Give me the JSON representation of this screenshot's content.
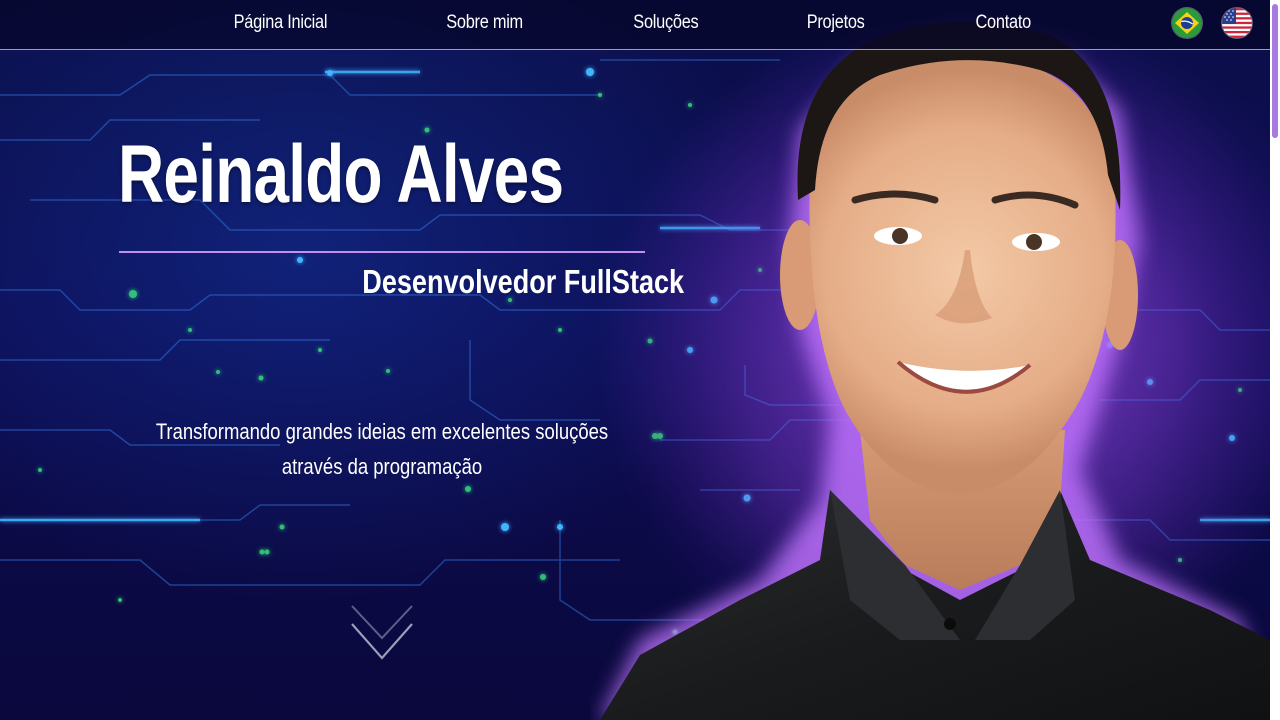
{
  "nav": {
    "items": [
      {
        "label": "Página Inicial"
      },
      {
        "label": "Sobre mim"
      },
      {
        "label": "Soluções"
      },
      {
        "label": "Projetos"
      },
      {
        "label": "Contato"
      }
    ],
    "languages": [
      {
        "flag": "brazil-flag-icon"
      },
      {
        "flag": "usa-flag-icon"
      }
    ]
  },
  "hero": {
    "name": "Reinaldo Alves",
    "role": "Desenvolvedor FullStack",
    "tagline_line1": "Transformando grandes ideias em excelentes soluções",
    "tagline_line2": "através da programação",
    "scroll_icon": "chevron-down-icon"
  },
  "colors": {
    "accent": "#c58df0",
    "background": "#0b0f4a",
    "glow": "#9646e6",
    "circuit": "#2a8cff"
  }
}
